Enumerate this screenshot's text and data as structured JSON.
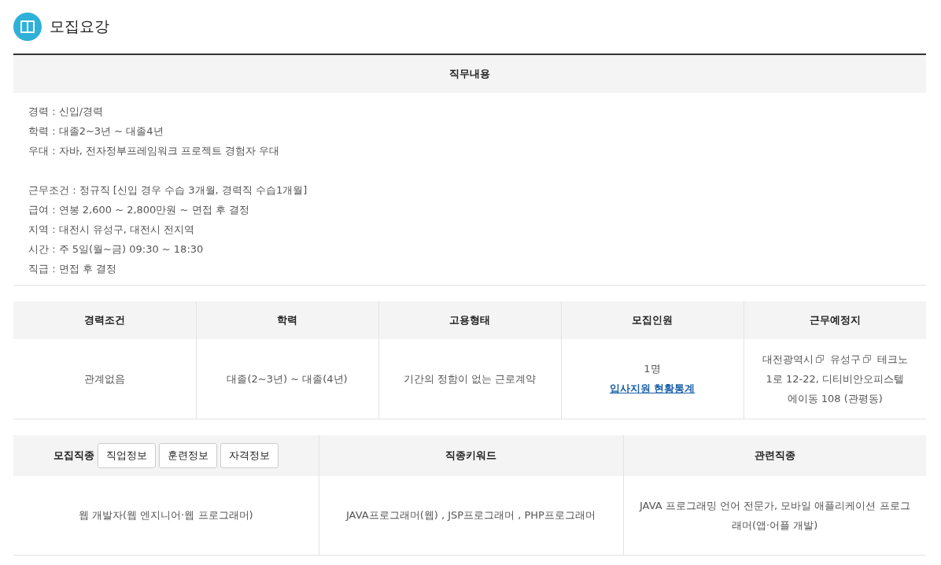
{
  "section": {
    "title": "모집요강"
  },
  "duty": {
    "header": "직무내용",
    "paragraphs": [
      [
        "경력 : 신입/경력",
        "학력 : 대졸2~3년 ~ 대졸4년",
        "우대 : 자바, 전자정부프레임워크 프로젝트 경험자 우대"
      ],
      [
        "근무조건 : 정규직 [신입 경우 수습 3개월, 경력직 수습1개월]",
        "급여 : 연봉 2,600 ~ 2,800만원 ~ 면접 후 결정",
        "지역 : 대전시 유성구, 대전시 전지역",
        "시간 : 주 5일(월~금) 09:30 ~ 18:30",
        "직급 : 면접 후 결정"
      ]
    ]
  },
  "summary": {
    "columns": [
      "경력조건",
      "학력",
      "고용형태",
      "모집인원",
      "근무예정지"
    ],
    "cells": [
      {
        "kind": "text",
        "text": "관계없음"
      },
      {
        "kind": "text",
        "text": "대졸(2~3년) ~ 대졸(4년)"
      },
      {
        "kind": "text",
        "text": "기간의 정함이 없는 근로계약"
      },
      {
        "kind": "count",
        "text": "1명",
        "link": "입사지원 현황통계"
      },
      {
        "kind": "address",
        "links": [
          "대전광역시",
          "유성구"
        ],
        "text": "테크노1로 12-22, 디티비안오피스텔 에이동 108 (관평동)"
      }
    ]
  },
  "jobs": {
    "header_label": "모집직종",
    "header_buttons": [
      "직업정보",
      "훈련정보",
      "자격정보"
    ],
    "columns": [
      "직종키워드",
      "관련직종"
    ],
    "cells": [
      "웹 개발자(웹 엔지니어·웹 프로그래머)",
      "JAVA프로그래머(웹) , JSP프로그래머 , PHP프로그래머",
      "JAVA 프로그래밍 언어 전문가, 모바일 애플리케이션 프로그래머(앱·어플 개발)"
    ]
  }
}
